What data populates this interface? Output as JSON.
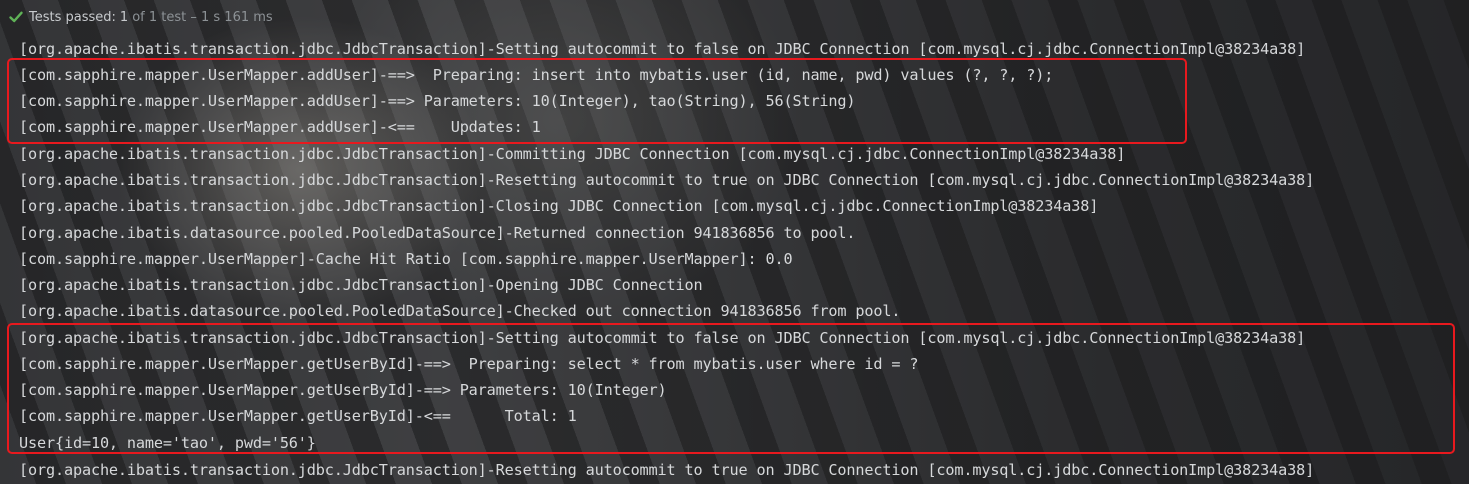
{
  "status": {
    "label": "Tests passed:",
    "count": "1",
    "rest": "of 1 test – 1 s 161 ms",
    "icon": "check-icon",
    "icon_color": "#5fb257"
  },
  "console": {
    "lines": [
      "[org.apache.ibatis.transaction.jdbc.JdbcTransaction]-Setting autocommit to false on JDBC Connection [com.mysql.cj.jdbc.ConnectionImpl@38234a38]",
      "[com.sapphire.mapper.UserMapper.addUser]-==>  Preparing: insert into mybatis.user (id, name, pwd) values (?, ?, ?);",
      "[com.sapphire.mapper.UserMapper.addUser]-==> Parameters: 10(Integer), tao(String), 56(String)",
      "[com.sapphire.mapper.UserMapper.addUser]-<==    Updates: 1",
      "[org.apache.ibatis.transaction.jdbc.JdbcTransaction]-Committing JDBC Connection [com.mysql.cj.jdbc.ConnectionImpl@38234a38]",
      "[org.apache.ibatis.transaction.jdbc.JdbcTransaction]-Resetting autocommit to true on JDBC Connection [com.mysql.cj.jdbc.ConnectionImpl@38234a38]",
      "[org.apache.ibatis.transaction.jdbc.JdbcTransaction]-Closing JDBC Connection [com.mysql.cj.jdbc.ConnectionImpl@38234a38]",
      "[org.apache.ibatis.datasource.pooled.PooledDataSource]-Returned connection 941836856 to pool.",
      "[com.sapphire.mapper.UserMapper]-Cache Hit Ratio [com.sapphire.mapper.UserMapper]: 0.0",
      "[org.apache.ibatis.transaction.jdbc.JdbcTransaction]-Opening JDBC Connection",
      "[org.apache.ibatis.datasource.pooled.PooledDataSource]-Checked out connection 941836856 from pool.",
      "[org.apache.ibatis.transaction.jdbc.JdbcTransaction]-Setting autocommit to false on JDBC Connection [com.mysql.cj.jdbc.ConnectionImpl@38234a38]",
      "[com.sapphire.mapper.UserMapper.getUserById]-==>  Preparing: select * from mybatis.user where id = ?",
      "[com.sapphire.mapper.UserMapper.getUserById]-==> Parameters: 10(Integer)",
      "[com.sapphire.mapper.UserMapper.getUserById]-<==      Total: 1",
      "User{id=10, name='tao', pwd='56'}",
      "[org.apache.ibatis.transaction.jdbc.JdbcTransaction]-Resetting autocommit to true on JDBC Connection [com.mysql.cj.jdbc.ConnectionImpl@38234a38]"
    ]
  },
  "annotations": {
    "box_color": "#e8191e"
  }
}
